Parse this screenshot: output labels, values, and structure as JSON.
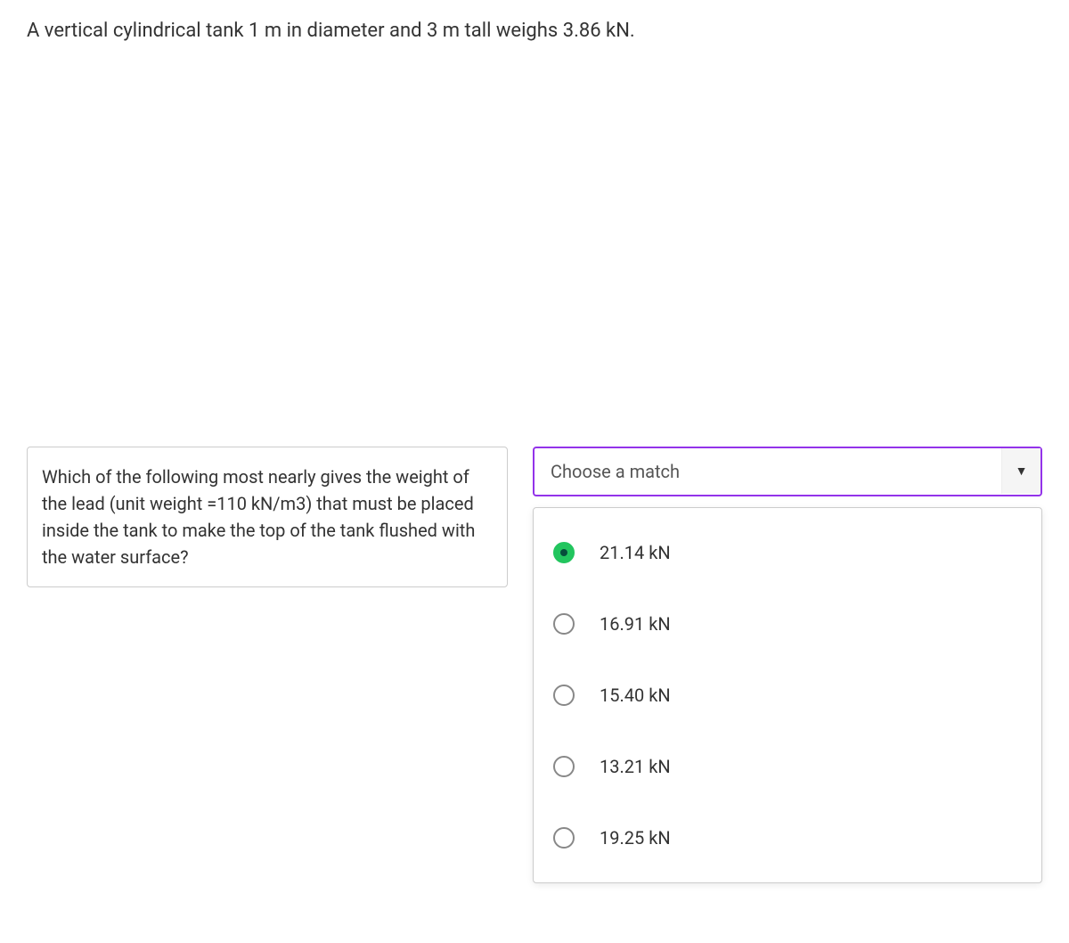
{
  "problem_statement": "A vertical cylindrical tank 1 m in diameter and 3 m tall weighs 3.86 kN.",
  "question_text": "Which of the following most nearly gives the weight of the lead (unit weight =110 kN/m3) that must be placed inside the tank to make the top of the tank flushed with the water surface?",
  "dropdown": {
    "placeholder": "Choose a match"
  },
  "options": [
    {
      "label": "21.14 kN",
      "selected": true
    },
    {
      "label": "16.91 kN",
      "selected": false
    },
    {
      "label": "15.40 kN",
      "selected": false
    },
    {
      "label": "13.21 kN",
      "selected": false
    },
    {
      "label": "19.25 kN",
      "selected": false
    }
  ]
}
